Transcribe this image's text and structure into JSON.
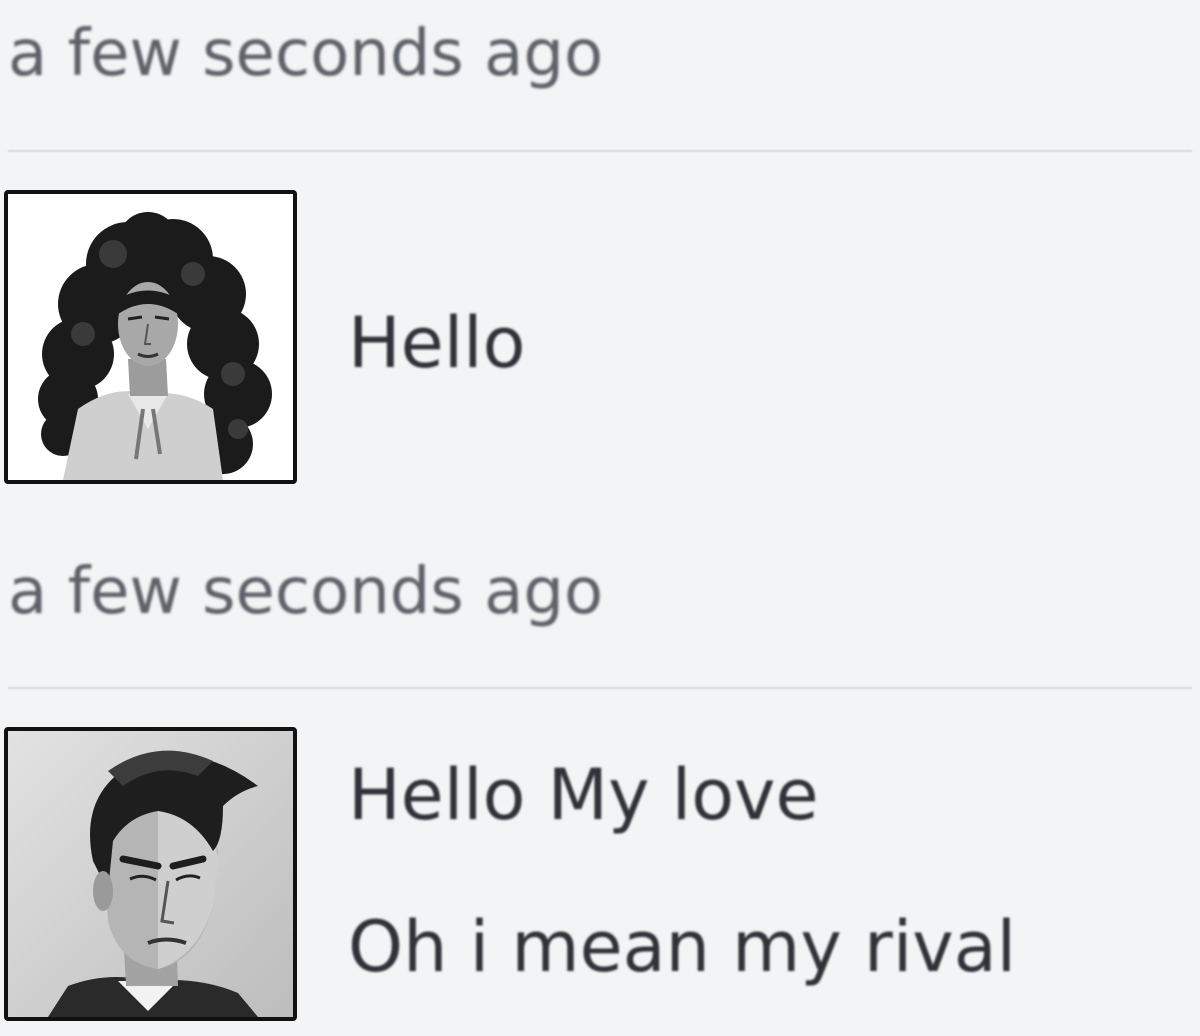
{
  "messages": [
    {
      "timestamp": "a few seconds ago",
      "avatar": "woman-curly-hair-portrait",
      "lines": [
        "Hello"
      ]
    },
    {
      "timestamp": "a few seconds ago",
      "avatar": "man-dark-hair-portrait",
      "lines": [
        "Hello My love",
        "Oh i mean my rival"
      ]
    }
  ],
  "colors": {
    "background": "#f3f4f5",
    "timestamp": "#5d6168",
    "message_text": "#2f3238",
    "divider": "#d9dadc",
    "avatar_border": "#111111"
  }
}
